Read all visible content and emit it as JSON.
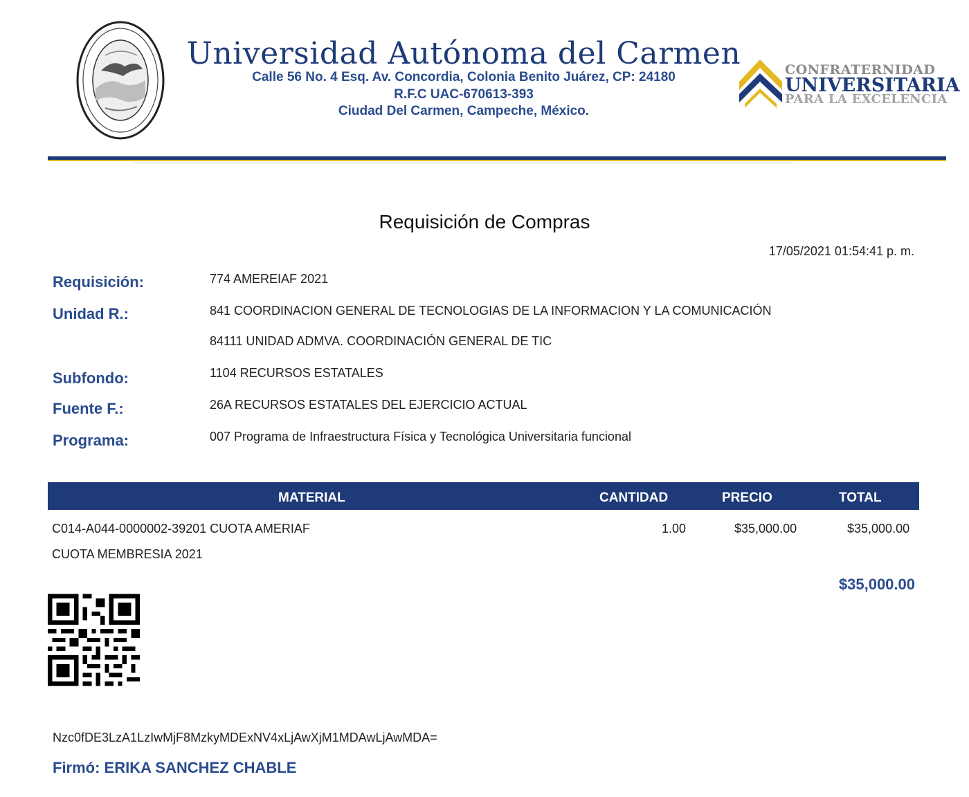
{
  "header": {
    "university": "Universidad Autónoma del Carmen",
    "address_line1": "Calle 56 No. 4 Esq. Av. Concordia, Colonia Benito Juárez, CP: 24180",
    "address_line2": "R.F.C UAC-670613-393",
    "address_line3": "Ciudad Del Carmen, Campeche, México.",
    "logo_line1": "CONFRATERNIDAD",
    "logo_line2": "UNIVERSITARIA",
    "logo_line3": "PARA LA EXCELENCIA",
    "seal_icon": "university-seal",
    "logo_icon": "chevron-logo"
  },
  "document": {
    "title": "Requisición de Compras",
    "datetime": "17/05/2021 01:54:41 p. m."
  },
  "fields": {
    "requisicion_label": "Requisición:",
    "requisicion_value": "774  AMEREIAF 2021",
    "unidad_label": "Unidad R.:",
    "unidad_value1": "841 COORDINACION GENERAL DE TECNOLOGIAS DE LA INFORMACION Y LA COMUNICACIÓN",
    "unidad_value2": "84111 UNIDAD ADMVA. COORDINACIÓN GENERAL DE TIC",
    "subfondo_label": "Subfondo:",
    "subfondo_value": "1104 RECURSOS ESTATALES",
    "fuente_label": "Fuente F.:",
    "fuente_value": "26A RECURSOS ESTATALES DEL EJERCICIO ACTUAL",
    "programa_label": "Programa:",
    "programa_value": "007 Programa de Infraestructura Física y Tecnológica Universitaria funcional"
  },
  "table": {
    "headers": [
      "MATERIAL",
      "CANTIDAD",
      "PRECIO",
      "TOTAL"
    ],
    "rows": [
      {
        "material": "C014-A044-0000002-39201 CUOTA AMERIAF",
        "description": "CUOTA MEMBRESIA 2021",
        "cantidad": "1.00",
        "precio": "$35,000.00",
        "total": "$35,000.00"
      }
    ],
    "grand_total": "$35,000.00"
  },
  "footer": {
    "qr_icon": "qr-code",
    "hash": "Nzc0fDE3LzA1LzIwMjF8MzkyMDExNV4xLjAwXjM1MDAwLjAwMDA=",
    "signed": "Firmó: ERIKA SANCHEZ CHABLE"
  },
  "colors": {
    "navy": "#1e3a78",
    "label_blue": "#2a4c8e",
    "gold": "#e4b821"
  }
}
